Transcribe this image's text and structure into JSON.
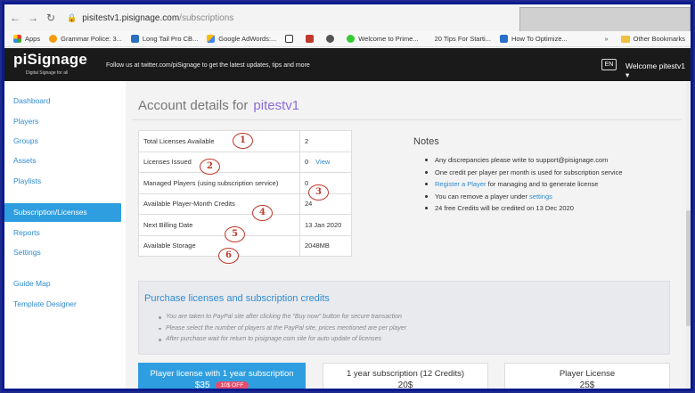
{
  "browser": {
    "url_host": "pisitestv1.pisignage.com",
    "url_path": "/subscriptions",
    "bookmarks": [
      "Apps",
      "Grammar Police: 3...",
      "Long Tail Pro CB...",
      "Google AdWords:...",
      "Welcome to Prime...",
      "20 Tips For Starti...",
      "How To Optimize..."
    ],
    "other_bookmarks": "Other Bookmarks",
    "overflow": "»"
  },
  "header": {
    "logo": "piSignage",
    "logo_sub": "Digital Signage for all",
    "follow": "Follow us at twitter.com/piSignage to get the latest updates, tips and more",
    "lang": "EN",
    "welcome": "Welcome pitestv1 ▾"
  },
  "sidebar": {
    "items": [
      {
        "label": "Dashboard"
      },
      {
        "label": "Players"
      },
      {
        "label": "Groups"
      },
      {
        "label": "Assets"
      },
      {
        "label": "Playlists"
      },
      {
        "label": "Subscription/Licenses"
      },
      {
        "label": "Reports"
      },
      {
        "label": "Settings"
      },
      {
        "label": "Guide Map"
      },
      {
        "label": "Template Designer"
      }
    ]
  },
  "account": {
    "title": "Account details for",
    "user": "pitestv1"
  },
  "licenses": {
    "rows": [
      {
        "label": "Total Licenses Available",
        "value": "2",
        "badge": "1"
      },
      {
        "label": "Licenses Issued",
        "value": "0",
        "link": "View",
        "badge": "2"
      },
      {
        "label": "Managed Players (using subscription service)",
        "value": "0",
        "badge": "3"
      },
      {
        "label": "Available Player-Month Credits",
        "value": "24",
        "badge": "4"
      },
      {
        "label": "Next Billing Date",
        "value": "13 Jan 2020",
        "badge": "5"
      },
      {
        "label": "Available Storage",
        "value": "2048MB",
        "badge": "6"
      }
    ]
  },
  "notes": {
    "title": "Notes",
    "items": [
      {
        "text": "Any discrepancies please write to support@pisignage.com"
      },
      {
        "text": "One credit per player per month is used for subscription service"
      },
      {
        "link": "Register a Player",
        "text": " for managing and to generate license"
      },
      {
        "text": "You can remove a player under ",
        "link": "settings"
      },
      {
        "credits": "24",
        "text": " free Credits will be credited on ",
        "date": "13 Dec 2020"
      }
    ]
  },
  "purchase": {
    "title": "Purchase licenses and subscription credits",
    "items": [
      "You are taken to PayPal site after clicking the \"Buy now\" button for secure transaction",
      "Please select the number of players at the PayPal site, prices mentioned are per player",
      "After purchase wait for return to pisignage.com site for auto update of licenses"
    ]
  },
  "cards": [
    {
      "title": "Player license with 1 year subscription",
      "price": "$35",
      "discount": "10$ OFF"
    },
    {
      "title": "1 year subscription (12 Credits)",
      "price": "20$"
    },
    {
      "title": "Player License",
      "price": "25$"
    }
  ],
  "colors": {
    "accent": "#2f9ee0",
    "link": "#2f8bd0",
    "username": "#8b6cd8",
    "annotation": "#c0392b",
    "discount": "#e74c6c"
  }
}
